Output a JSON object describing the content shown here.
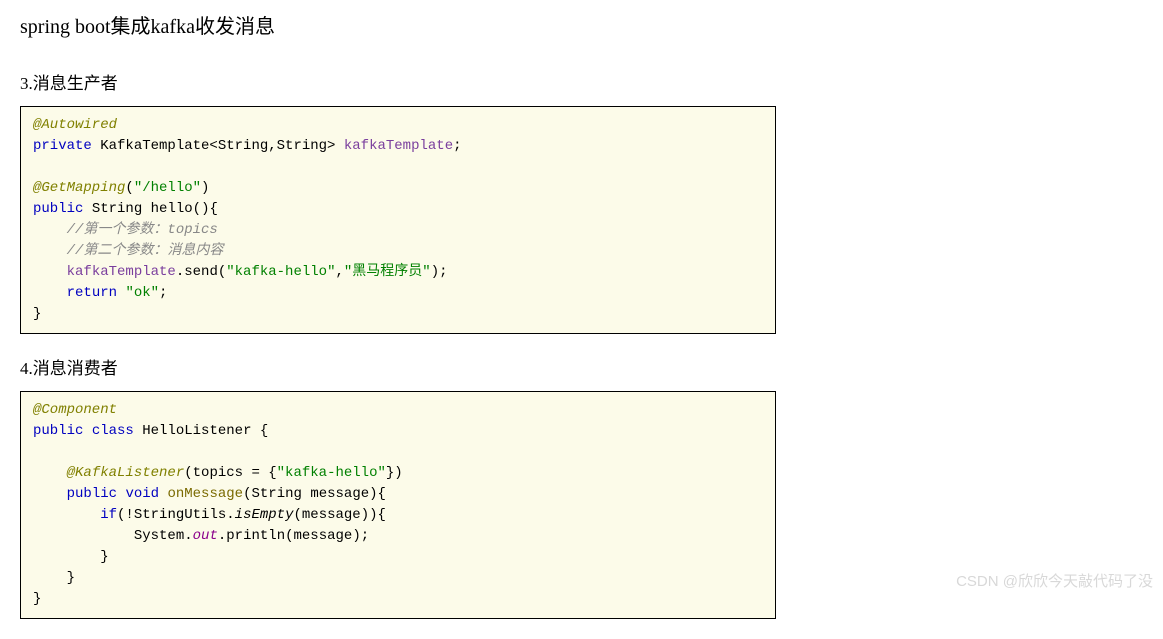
{
  "title": "spring boot集成kafka收发消息",
  "section1": {
    "heading": "3.消息生产者",
    "code": {
      "anno1": "@Autowired",
      "kw_private": "private",
      "type_template": "KafkaTemplate<String,String>",
      "field_template": "kafkaTemplate",
      "anno2": "@GetMapping",
      "str_hello": "\"/hello\"",
      "kw_public": "public",
      "type_string": "String",
      "method_hello": "hello",
      "comment1": "//第一个参数：topics",
      "comment2": "//第二个参数：消息内容",
      "field_kt": "kafkaTemplate",
      "method_send": "send",
      "str_topic": "\"kafka-hello\"",
      "str_msg": "\"黑马程序员\"",
      "kw_return": "return",
      "str_ok": "\"ok\""
    }
  },
  "section2": {
    "heading": "4.消息消费者",
    "code": {
      "anno1": "@Component",
      "kw_public": "public",
      "kw_class": "class",
      "class_name": "HelloListener",
      "anno2": "@KafkaListener",
      "str_topic": "\"kafka-hello\"",
      "kw_void": "void",
      "method_onmsg": "onMessage",
      "type_string": "String",
      "param_msg": "message",
      "kw_if": "if",
      "class_su": "StringUtils",
      "method_isempty": "isEmpty",
      "class_sys": "System",
      "field_out": "out",
      "method_println": "println"
    }
  },
  "watermark": "CSDN @欣欣今天敲代码了没"
}
